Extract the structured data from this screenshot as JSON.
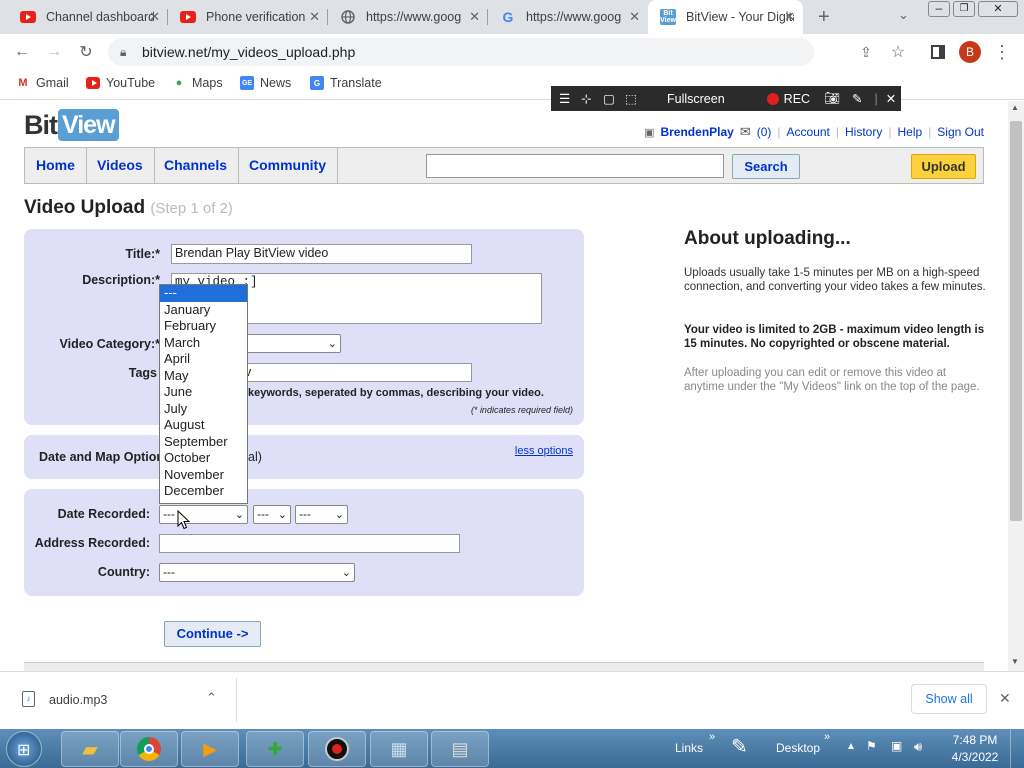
{
  "browser": {
    "tabs": [
      {
        "title": "Channel dashboard",
        "icon": "youtube-icon"
      },
      {
        "title": "Phone verification",
        "icon": "youtube-icon"
      },
      {
        "title": "https://www.goog",
        "icon": "globe-icon"
      },
      {
        "title": "https://www.goog",
        "icon": "google-icon"
      },
      {
        "title": "BitView - Your Digital",
        "icon": "bitview-icon",
        "active": true
      }
    ],
    "url": "bitview.net/my_videos_upload.php",
    "profile_initial": "B",
    "bookmarks": [
      "Gmail",
      "YouTube",
      "Maps",
      "News",
      "Translate"
    ]
  },
  "recorder": {
    "fullscreen_label": "Fullscreen",
    "rec_label": "REC"
  },
  "site": {
    "logo_bit": "Bit",
    "logo_view": "View",
    "user": {
      "username": "BrendenPlay",
      "inbox_count": "(0)",
      "links": [
        "Account",
        "History",
        "Help",
        "Sign Out"
      ]
    },
    "nav": [
      "Home",
      "Videos",
      "Channels",
      "Community"
    ],
    "search_label": "Search",
    "upload_label": "Upload"
  },
  "form": {
    "heading": "Video Upload",
    "step": "(Step 1 of 2)",
    "title_label": "Title:*",
    "title_value": "Brendan Play BitView video",
    "description_label": "Description:*",
    "description_value": "my video :]",
    "category_label": "Video Category:*",
    "category_value": "ation",
    "tags_label": "Tags",
    "tags_value": "v",
    "tags_hint": "keywords, seperated by commas, describing your video.",
    "required_note": "(* indicates required field)",
    "date_map_label": "Date and Map Option",
    "date_map_optional": "al)",
    "less_options": "less options",
    "date_recorded_label": "Date Recorded:",
    "date_month": "---",
    "date_day": "---",
    "date_year": "---",
    "address_label": "Address Recorded:",
    "country_label": "Country:",
    "country_value": "---",
    "continue_label": "Continue ->"
  },
  "month_dropdown": [
    "---",
    "January",
    "February",
    "March",
    "April",
    "May",
    "June",
    "July",
    "August",
    "September",
    "October",
    "November",
    "December"
  ],
  "about": {
    "title": "About uploading...",
    "p1": "Uploads usually take 1-5 minutes per MB on a high-speed connection, and converting your video takes a few minutes.",
    "p2": "Your video is limited to 2GB - maximum video length is 15 minutes. No copyrighted or obscene material.",
    "p3": "After uploading you can edit or remove this video at anytime under the \"My Videos\" link on the top of the page."
  },
  "download_bar": {
    "file": "audio.mp3",
    "show_all": "Show all"
  },
  "taskbar": {
    "links_label": "Links",
    "desktop_label": "Desktop",
    "time": "7:48 PM",
    "date": "4/3/2022"
  },
  "colors": {
    "panel": "#dfe0f8",
    "link": "#0033cc",
    "upload_button": "#fbd13c",
    "dropdown_highlight": "#1e6fd9"
  }
}
